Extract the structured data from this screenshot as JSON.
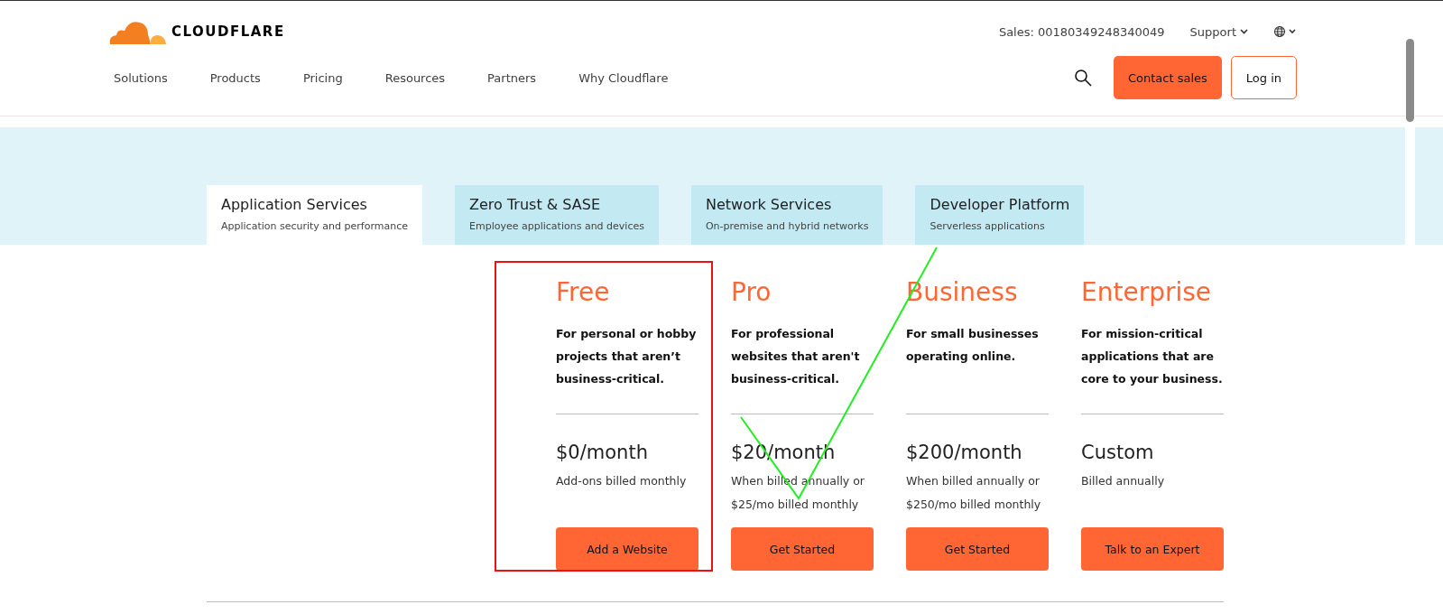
{
  "header": {
    "brand": "CLOUDFLARE",
    "sales": "Sales: 00180349248340049",
    "support": "Support",
    "nav": [
      "Solutions",
      "Products",
      "Pricing",
      "Resources",
      "Partners",
      "Why Cloudflare"
    ],
    "contact": "Contact sales",
    "login": "Log in"
  },
  "tabs": [
    {
      "title": "Application Services",
      "subtitle": "Application security and performance",
      "selected": true
    },
    {
      "title": "Zero Trust & SASE",
      "subtitle": "Employee applications and devices",
      "selected": false
    },
    {
      "title": "Network Services",
      "subtitle": "On-premise and hybrid networks",
      "selected": false
    },
    {
      "title": "Developer Platform",
      "subtitle": "Serverless applications",
      "selected": false
    }
  ],
  "plans": [
    {
      "name": "Free",
      "description": "For personal or hobby projects that aren’t business-critical.",
      "price": "$0/month",
      "billing": [
        "Add-ons billed monthly"
      ],
      "button": "Add a Website",
      "highlighted": true
    },
    {
      "name": "Pro",
      "description": "For professional websites that aren't business-critical.",
      "price": "$20/month",
      "billing": [
        "When billed annually or",
        "$25/mo billed monthly"
      ],
      "button": "Get Started",
      "highlighted": false
    },
    {
      "name": "Business",
      "description": "For small businesses operating online.",
      "price": "$200/month",
      "billing": [
        "When billed annually or",
        "$250/mo billed monthly"
      ],
      "button": "Get Started",
      "highlighted": false
    },
    {
      "name": "Enterprise",
      "description": "For mission-critical applications that are core to your business.",
      "price": "Custom",
      "billing": [
        "Billed annually"
      ],
      "button": "Talk to an Expert",
      "highlighted": false
    }
  ]
}
